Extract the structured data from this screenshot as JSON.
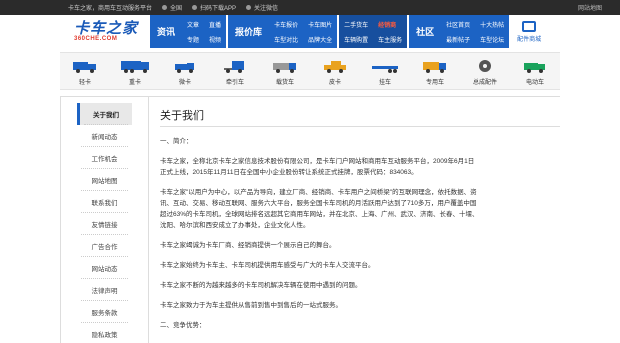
{
  "topbar": {
    "welcome": "卡车之家，商用车互动服务平台",
    "location": "全国",
    "app": "扫码下载APP",
    "follow": "关注微信",
    "map": "网站地图"
  },
  "logo": {
    "cn": "卡车之家",
    "en": "360CHE.COM"
  },
  "nav": {
    "info": "资讯",
    "info_sub": [
      "文章",
      "专题"
    ],
    "video_sub": [
      "直播",
      "视频"
    ],
    "price": "报价库",
    "price_sub": [
      "卡车报价",
      "车型对比"
    ],
    "pics_sub": [
      "卡车图片",
      "品牌大全"
    ],
    "used_sub": [
      "二手货车",
      "车辆购置"
    ],
    "dealer": "经销商",
    "dealer_sub": "车主服务",
    "community": "社区",
    "comm_sub1": [
      "社区首页",
      "最新帖子"
    ],
    "comm_sub2": [
      "十大热帖",
      "车型论坛"
    ],
    "mall": "配件商城"
  },
  "trucks": [
    "轻卡",
    "重卡",
    "微卡",
    "牵引车",
    "载货车",
    "皮卡",
    "挂车",
    "专用车",
    "总成配件",
    "电动车"
  ],
  "sidebar": {
    "items": [
      "关于我们",
      "新闻动态",
      "工作机会",
      "网站地图",
      "联系我们",
      "友情链接",
      "广告合作",
      "网站动态",
      "法律声明",
      "服务条款",
      "隐私政策"
    ]
  },
  "main": {
    "title": "关于我们",
    "section1": "一、简介：",
    "p1": "卡车之家，全称北京卡车之家信息技术股份有限公司，是卡车门户网站和商用车互动服务平台，2009年6月1日正式上线，2015年11月11日在全国中小企业股份转让系统正式挂牌，股票代码：834063。",
    "p2": "卡车之家\"以用户为中心，以产品为导向，建立厂商、经销商、卡车用户之间桥梁\"的互联网理念，依托数据、资讯、互动、交易、移动互联网、服务六大平台，服务全国卡车司机的月活跃用户达到了710多万，用户覆盖中国超过63%的卡车司机，全球网站排名远超其它商用车网站，并在北京、上海、广州、武汉、济南、长春、十堰、沈阳、哈尔滨和西安成立了办事处，企业文化人性。",
    "p3": "卡车之家竭诚为卡车厂商、经销商提供一个展示自己的舞台。",
    "p4": "卡车之家始终为卡车主、卡车司机提供用车感受与广大的卡车人交流平台。",
    "p5": "卡车之家不断的为越来越多的卡车司机解决车辆在使用中遇到的问题。",
    "p6": "卡车之家致力于为车主提供从售前到售中到售后的一站式服务。",
    "section2": "二、竞争优势："
  }
}
